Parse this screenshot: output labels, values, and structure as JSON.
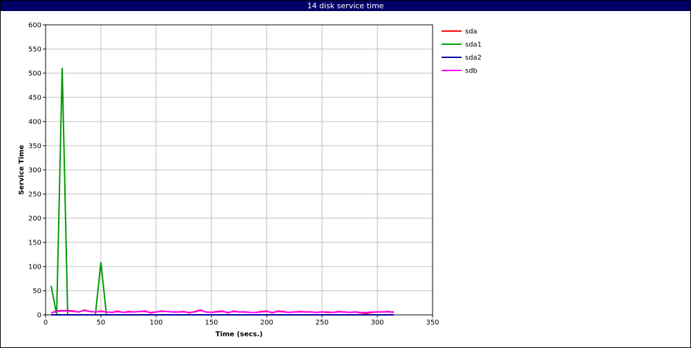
{
  "title": "14 disk service time",
  "colors": {
    "titlebar": "#000066",
    "grid": "#bfbfbf"
  },
  "chart_data": {
    "type": "line",
    "xlabel": "Time (secs.)",
    "ylabel": "Service Time",
    "xlim": [
      0,
      350
    ],
    "ylim": [
      0,
      600
    ],
    "xticks": [
      0,
      50,
      100,
      150,
      200,
      250,
      300,
      350
    ],
    "yticks": [
      0,
      50,
      100,
      150,
      200,
      250,
      300,
      350,
      400,
      450,
      500,
      550,
      600
    ],
    "grid": true,
    "legend_position": "top-right outside",
    "x": [
      5,
      10,
      15,
      20,
      25,
      30,
      35,
      40,
      45,
      50,
      55,
      60,
      65,
      70,
      75,
      80,
      85,
      90,
      95,
      100,
      105,
      110,
      115,
      120,
      125,
      130,
      135,
      140,
      145,
      150,
      155,
      160,
      165,
      170,
      175,
      180,
      185,
      190,
      195,
      200,
      205,
      210,
      215,
      220,
      225,
      230,
      235,
      240,
      245,
      250,
      255,
      260,
      265,
      270,
      275,
      280,
      285,
      290,
      295,
      300,
      305,
      310,
      315
    ],
    "series": [
      {
        "name": "sda",
        "color": "#ff0000",
        "values": [
          4,
          8,
          9,
          9,
          8,
          6,
          10,
          7,
          6,
          8,
          6,
          5,
          8,
          5,
          7,
          6,
          7,
          8,
          4,
          6,
          8,
          7,
          6,
          6,
          7,
          4,
          7,
          10,
          6,
          5,
          7,
          8,
          4,
          8,
          6,
          6,
          5,
          5,
          7,
          8,
          4,
          8,
          7,
          5,
          6,
          7,
          6,
          6,
          5,
          6,
          5,
          5,
          7,
          6,
          5,
          6,
          4,
          3,
          5,
          6,
          6,
          7,
          5
        ]
      },
      {
        "name": "sda1",
        "color": "#009900",
        "values": [
          60,
          0,
          511,
          0,
          0,
          0,
          0,
          0,
          0,
          109,
          0,
          0,
          0,
          0,
          0,
          0,
          0,
          0,
          0,
          0,
          0,
          0,
          0,
          0,
          0,
          0,
          0,
          0,
          0,
          0,
          0,
          0,
          0,
          0,
          0,
          0,
          0,
          0,
          0,
          0,
          0,
          0,
          0,
          0,
          0,
          0,
          0,
          0,
          0,
          0,
          0,
          0,
          0,
          0,
          0,
          0,
          0,
          0,
          0,
          0,
          0,
          0,
          0
        ]
      },
      {
        "name": "sda2",
        "color": "#000099",
        "values": [
          0,
          0,
          0,
          0,
          0,
          0,
          0,
          0,
          0,
          0,
          0,
          0,
          0,
          0,
          0,
          0,
          0,
          0,
          0,
          0,
          0,
          0,
          0,
          0,
          0,
          0,
          0,
          0,
          0,
          0,
          0,
          0,
          0,
          0,
          0,
          0,
          0,
          0,
          0,
          0,
          0,
          0,
          0,
          0,
          0,
          0,
          0,
          0,
          0,
          0,
          0,
          0,
          0,
          0,
          0,
          0,
          0,
          0,
          0,
          0,
          0,
          0,
          0
        ]
      },
      {
        "name": "sdb",
        "color": "#ff00ff",
        "values": [
          4,
          7,
          8,
          8,
          7,
          6,
          9,
          7,
          6,
          7,
          6,
          5,
          7,
          5,
          6,
          6,
          7,
          7,
          5,
          6,
          7,
          7,
          6,
          6,
          6,
          5,
          6,
          9,
          6,
          5,
          6,
          7,
          5,
          7,
          6,
          6,
          5,
          5,
          6,
          7,
          5,
          7,
          6,
          5,
          6,
          6,
          6,
          6,
          5,
          6,
          6,
          5,
          6,
          6,
          5,
          6,
          5,
          5,
          6,
          6,
          6,
          6,
          6
        ]
      }
    ]
  }
}
